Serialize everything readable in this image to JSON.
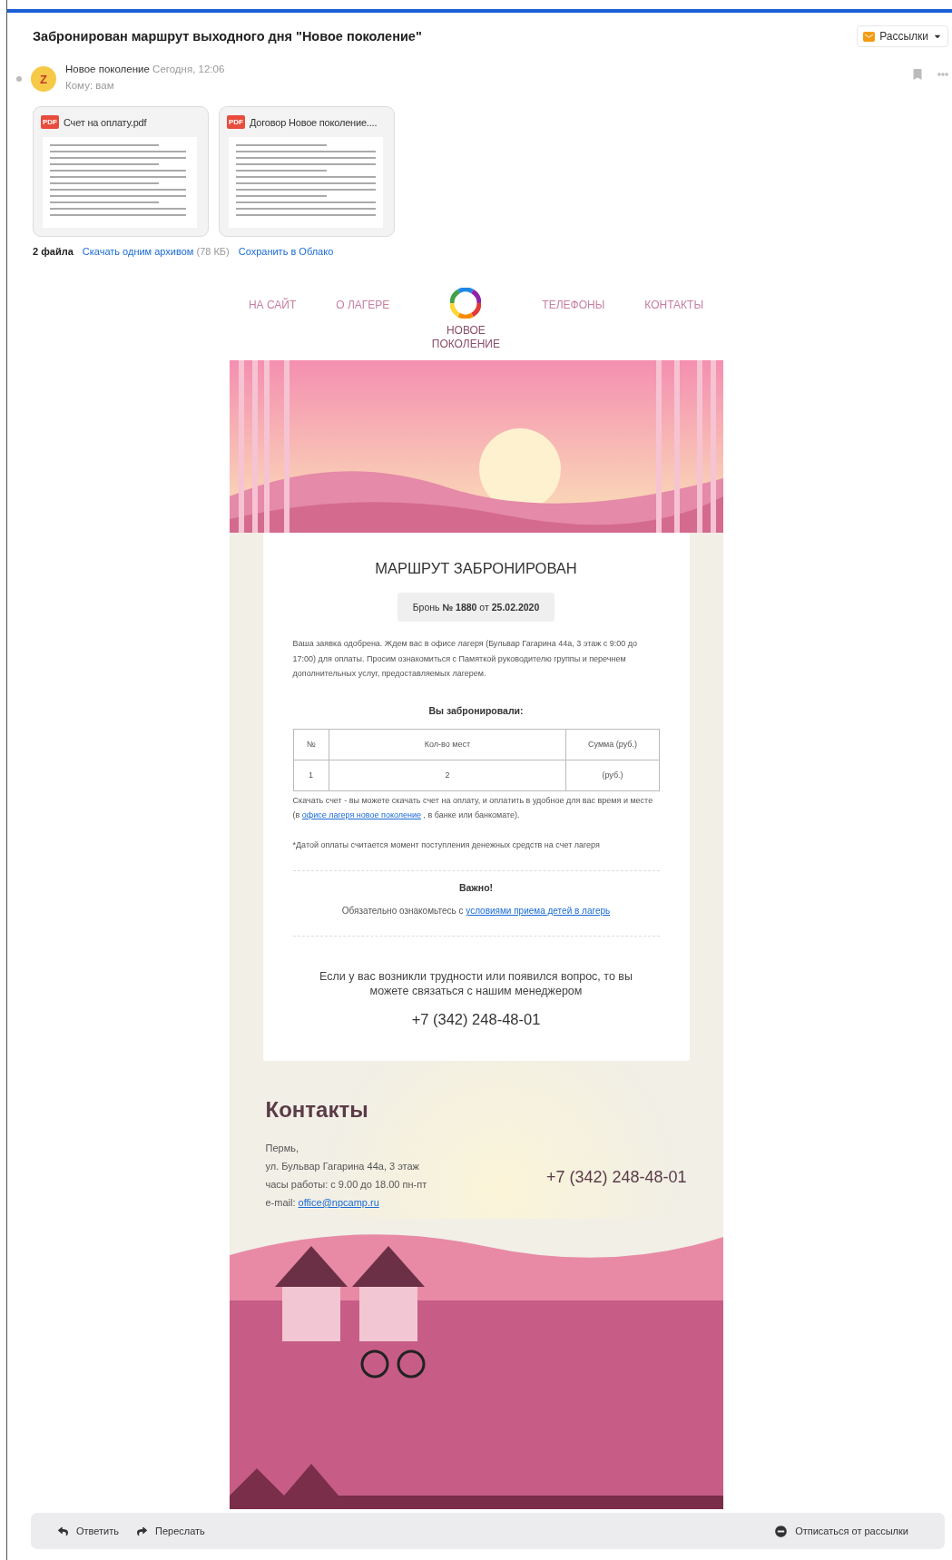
{
  "message": {
    "subject": "Забронирован маршрут выходного дня \"Новое поколение\"",
    "folder_button": "Рассылки",
    "avatar_letter": "Z",
    "sender": "Новое поколение",
    "time": "Сегодня, 12:06",
    "to": "Кому: вам"
  },
  "attachments": [
    {
      "badge": "PDF",
      "name": "Счет на оплату.pdf"
    },
    {
      "badge": "PDF",
      "name": "Договор Новое поколение...."
    }
  ],
  "files_summary": {
    "count": "2 файла",
    "download": "Скачать одним архивом",
    "size": "(78 КБ)",
    "save": "Сохранить в Облако"
  },
  "nav": {
    "left": [
      "НА САЙТ",
      "О ЛАГЕРЕ"
    ],
    "logo_text": "НОВОЕ ПОКОЛЕНИЕ",
    "right": [
      "ТЕЛЕФОНЫ",
      "КОНТАКТЫ"
    ]
  },
  "booking": {
    "title": "МАРШРУТ ЗАБРОНИРОВАН",
    "badge": "Бронь **№ 1880** от **25.02.2020**",
    "intro": "Ваша заявка одобрена. Ждем вас в офисе лагеря (Бульвар Гагарина 44а, 3 этаж с 9:00 до 17:00) для оплаты. Просим ознакомиться с Памяткой руководителю группы и перечнем дополнительных услуг, предоставляемых лагерем.",
    "table_title": "Вы забронировали:",
    "table": {
      "columns": [
        "№",
        "Кол-во мест",
        "Сумма (руб.)"
      ],
      "rows": [
        [
          "1",
          "2",
          "(руб.)"
        ]
      ]
    },
    "invoice_before": "Скачать счет - вы можете скачать счет на оплату, и оплатить в удобное для вас время и месте (в ",
    "invoice_link": "офисе лагеря новое поколение",
    "invoice_after": " , в банке или банкомате).",
    "note": "*Датой оплаты считается момент поступления денежных средств на счет лагеря",
    "important": "Важно!",
    "rules_before": "Обязательно ознакомьтесь с ",
    "rules_link": "условиями приема детей в лагерь",
    "question": "Если у вас возникли трудности или появился вопрос, то вы можете связаться с нашим менеджером",
    "phone": "+7 (342) 248-48-01"
  },
  "contacts": {
    "title": "Контакты",
    "lines": [
      "Пермь,",
      "ул. Бульвар Гагарина 44а, 3 этаж",
      "часы работы: с 9.00 до 18.00 пн-пт"
    ],
    "email_label": "e-mail: ",
    "email": "office@npcamp.ru",
    "phone": "+7 (342) 248-48-01"
  },
  "footer_actions": {
    "reply": "Ответить",
    "forward": "Переслать",
    "unsubscribe": "Отписаться от рассылки"
  }
}
